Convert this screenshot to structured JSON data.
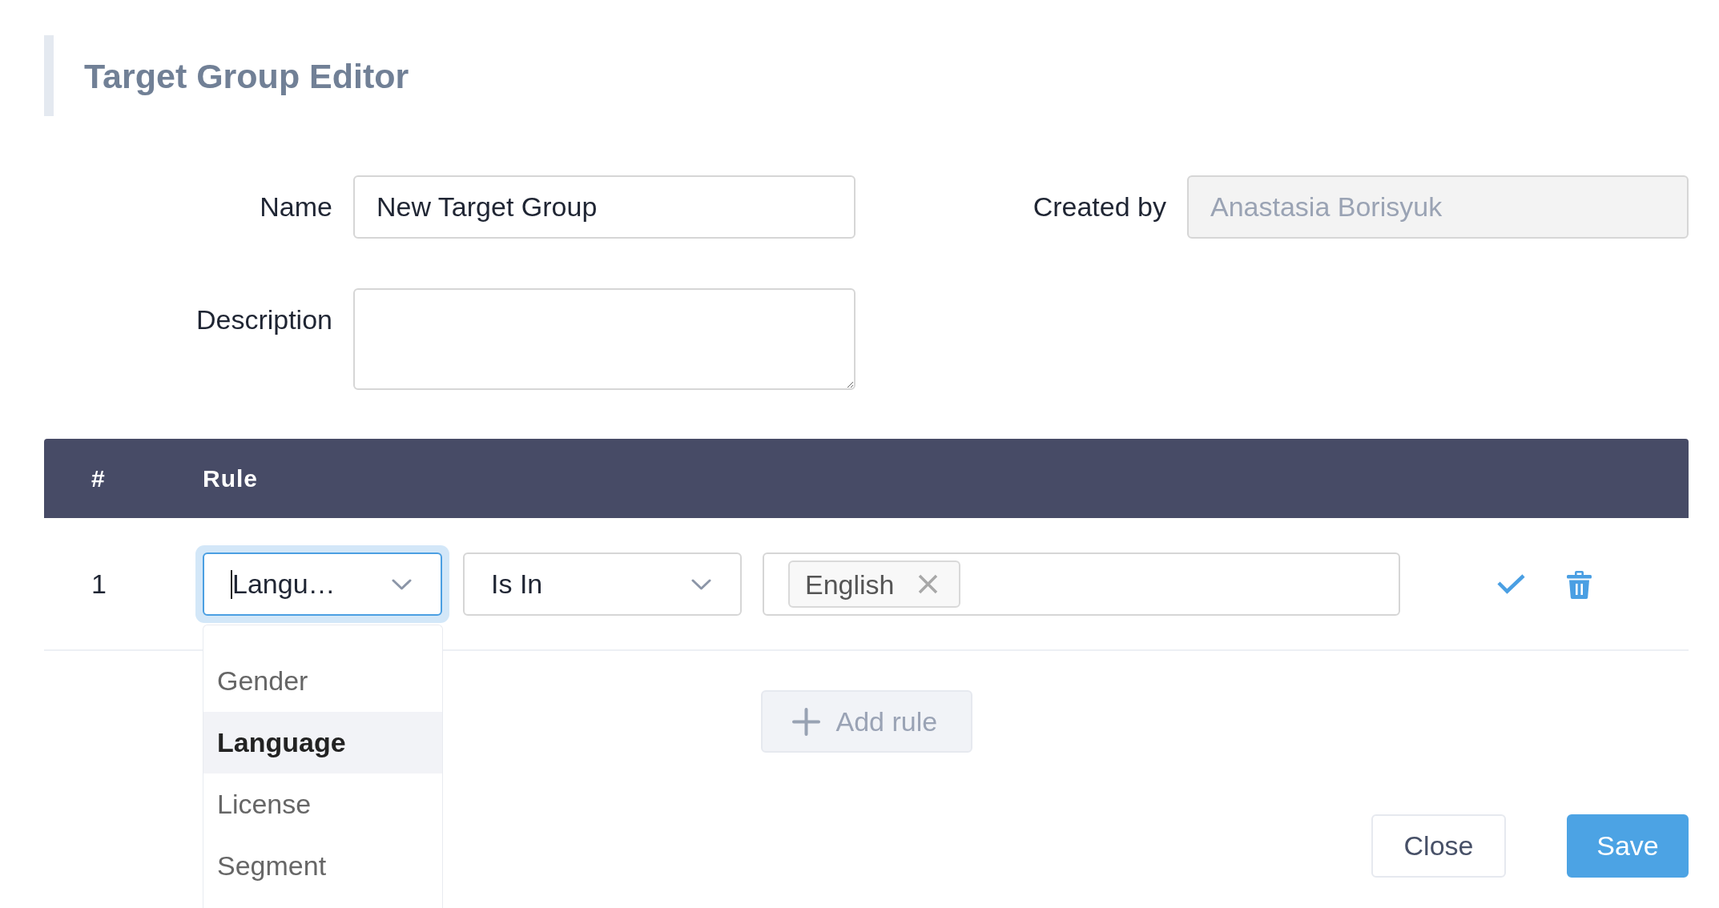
{
  "header": {
    "title": "Target Group Editor"
  },
  "form": {
    "name": {
      "label": "Name",
      "value": "New Target Group"
    },
    "created_by": {
      "label": "Created by",
      "value": "Anastasia Borisyuk",
      "disabled": true
    },
    "description": {
      "label": "Description"
    }
  },
  "rules_table": {
    "columns": [
      {
        "label": "#"
      },
      {
        "label": "Rule"
      }
    ],
    "rows": [
      {
        "number": "1",
        "attribute": {
          "value": "Langu…",
          "open": true,
          "options": [
            {
              "label": "Gender",
              "selected": false
            },
            {
              "label": "Language",
              "selected": true
            },
            {
              "label": "License",
              "selected": false
            },
            {
              "label": "Segment",
              "selected": false
            }
          ]
        },
        "operator": {
          "value": "Is In",
          "open": false
        },
        "values": [
          {
            "label": "English"
          }
        ]
      }
    ]
  },
  "add_rule": {
    "label": "Add rule"
  },
  "actions": [
    {
      "label": "Close",
      "kind": "secondary"
    },
    {
      "label": "Save",
      "kind": "primary"
    }
  ]
}
